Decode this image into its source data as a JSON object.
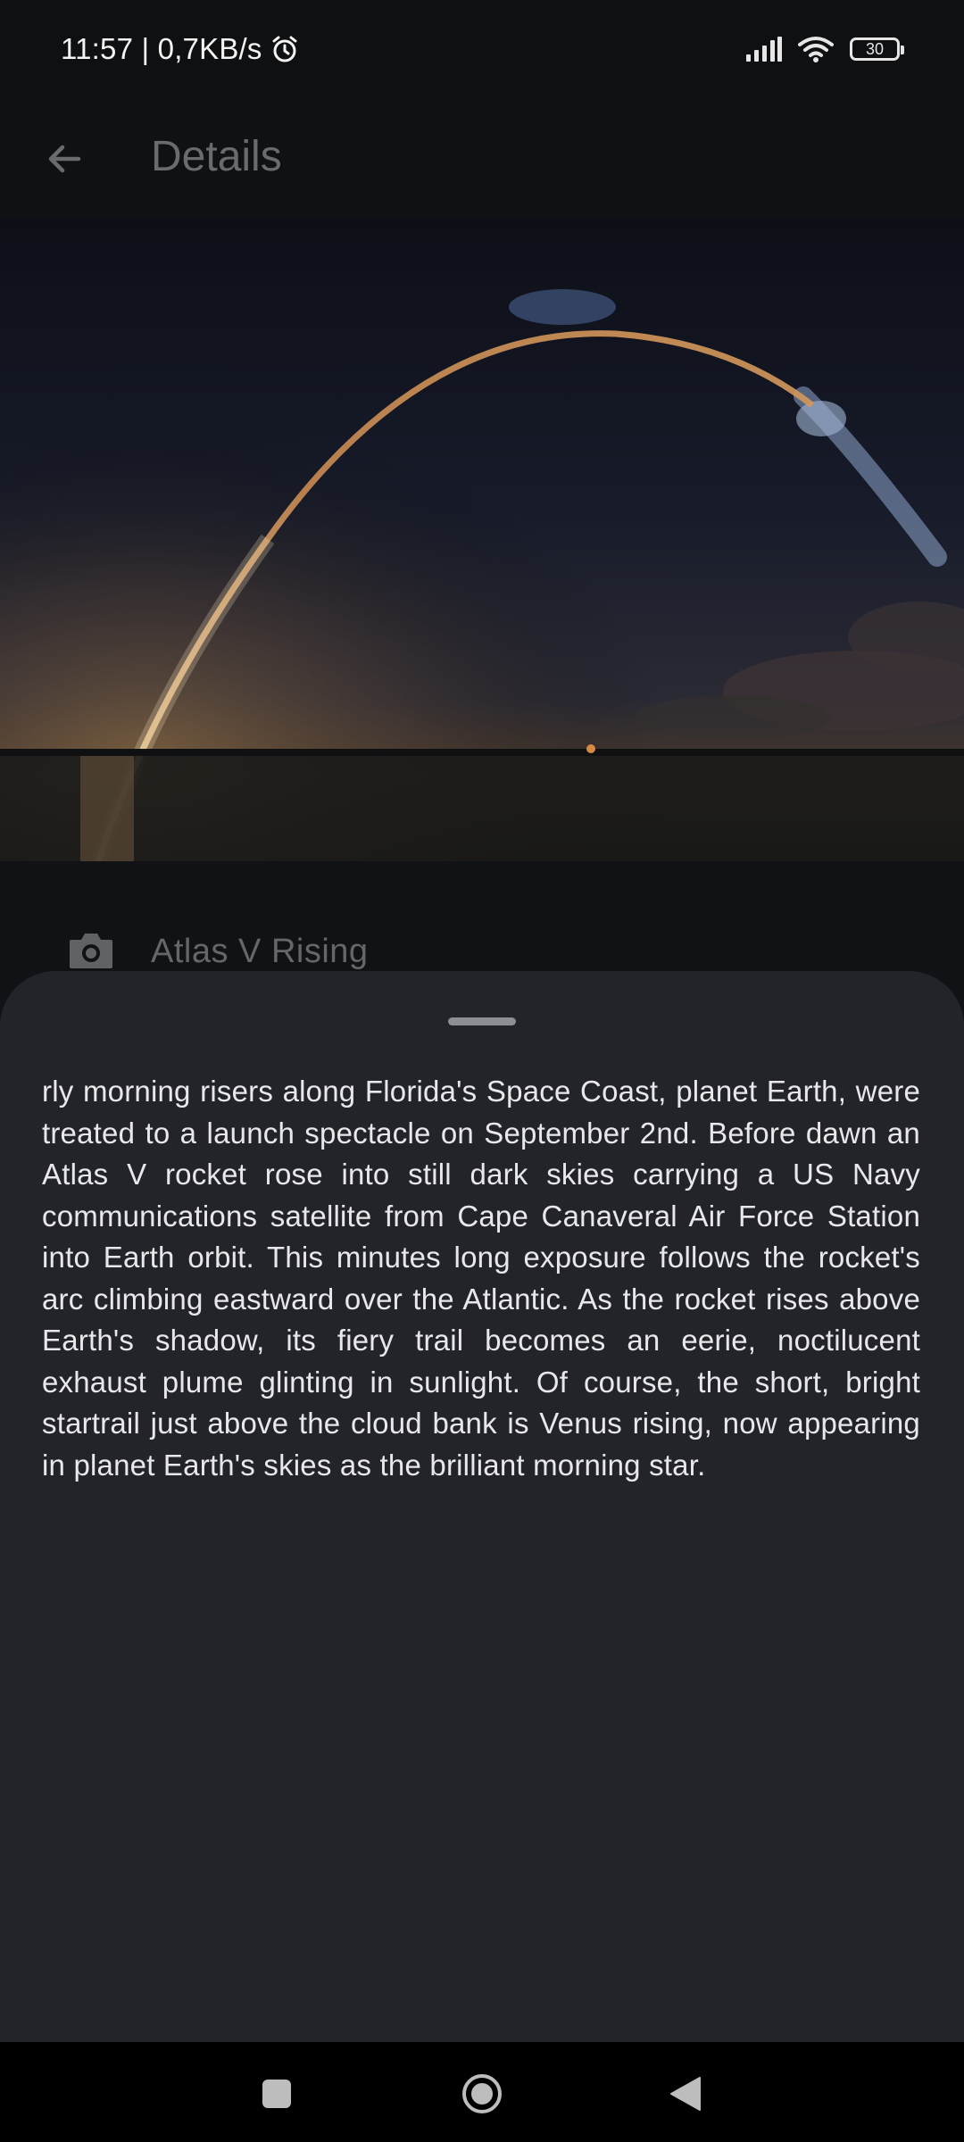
{
  "status_bar": {
    "time_speed": "11:57 | 0,7KB/s",
    "battery_level": "30",
    "icons": [
      "alarm-icon",
      "signal-icon",
      "wifi-icon",
      "battery-icon"
    ]
  },
  "app_bar": {
    "title": "Details",
    "back_icon": "arrow-left-icon"
  },
  "image": {
    "subject": "rocket launch arc over water at dawn"
  },
  "caption": {
    "icon": "camera-icon",
    "title": "Atlas V Rising"
  },
  "sheet": {
    "body": "rly morning risers along Florida's Space Coast, planet Earth, were treated to a launch spectacle on September 2nd. Before dawn an Atlas V rocket rose into still dark skies carrying a US Navy communications satellite from Cape Canaveral Air Force Station into Earth orbit. This minutes long exposure follows the rocket's arc climbing eastward over the Atlantic. As the rocket rises above Earth's shadow, its fiery trail becomes an eerie, noctilucent exhaust plume glinting in sunlight. Of course, the short, bright startrail just above the cloud bank is Venus rising, now appearing in planet Earth's skies as the brilliant morning star."
  },
  "nav_bar": {
    "buttons": [
      "recents-square-icon",
      "home-circle-icon",
      "back-triangle-icon"
    ]
  },
  "colors": {
    "sheet_bg": "#23242a",
    "body_text": "#e8e8ea",
    "dim_text": "#6a6b6f",
    "nav_bg": "#000000"
  }
}
